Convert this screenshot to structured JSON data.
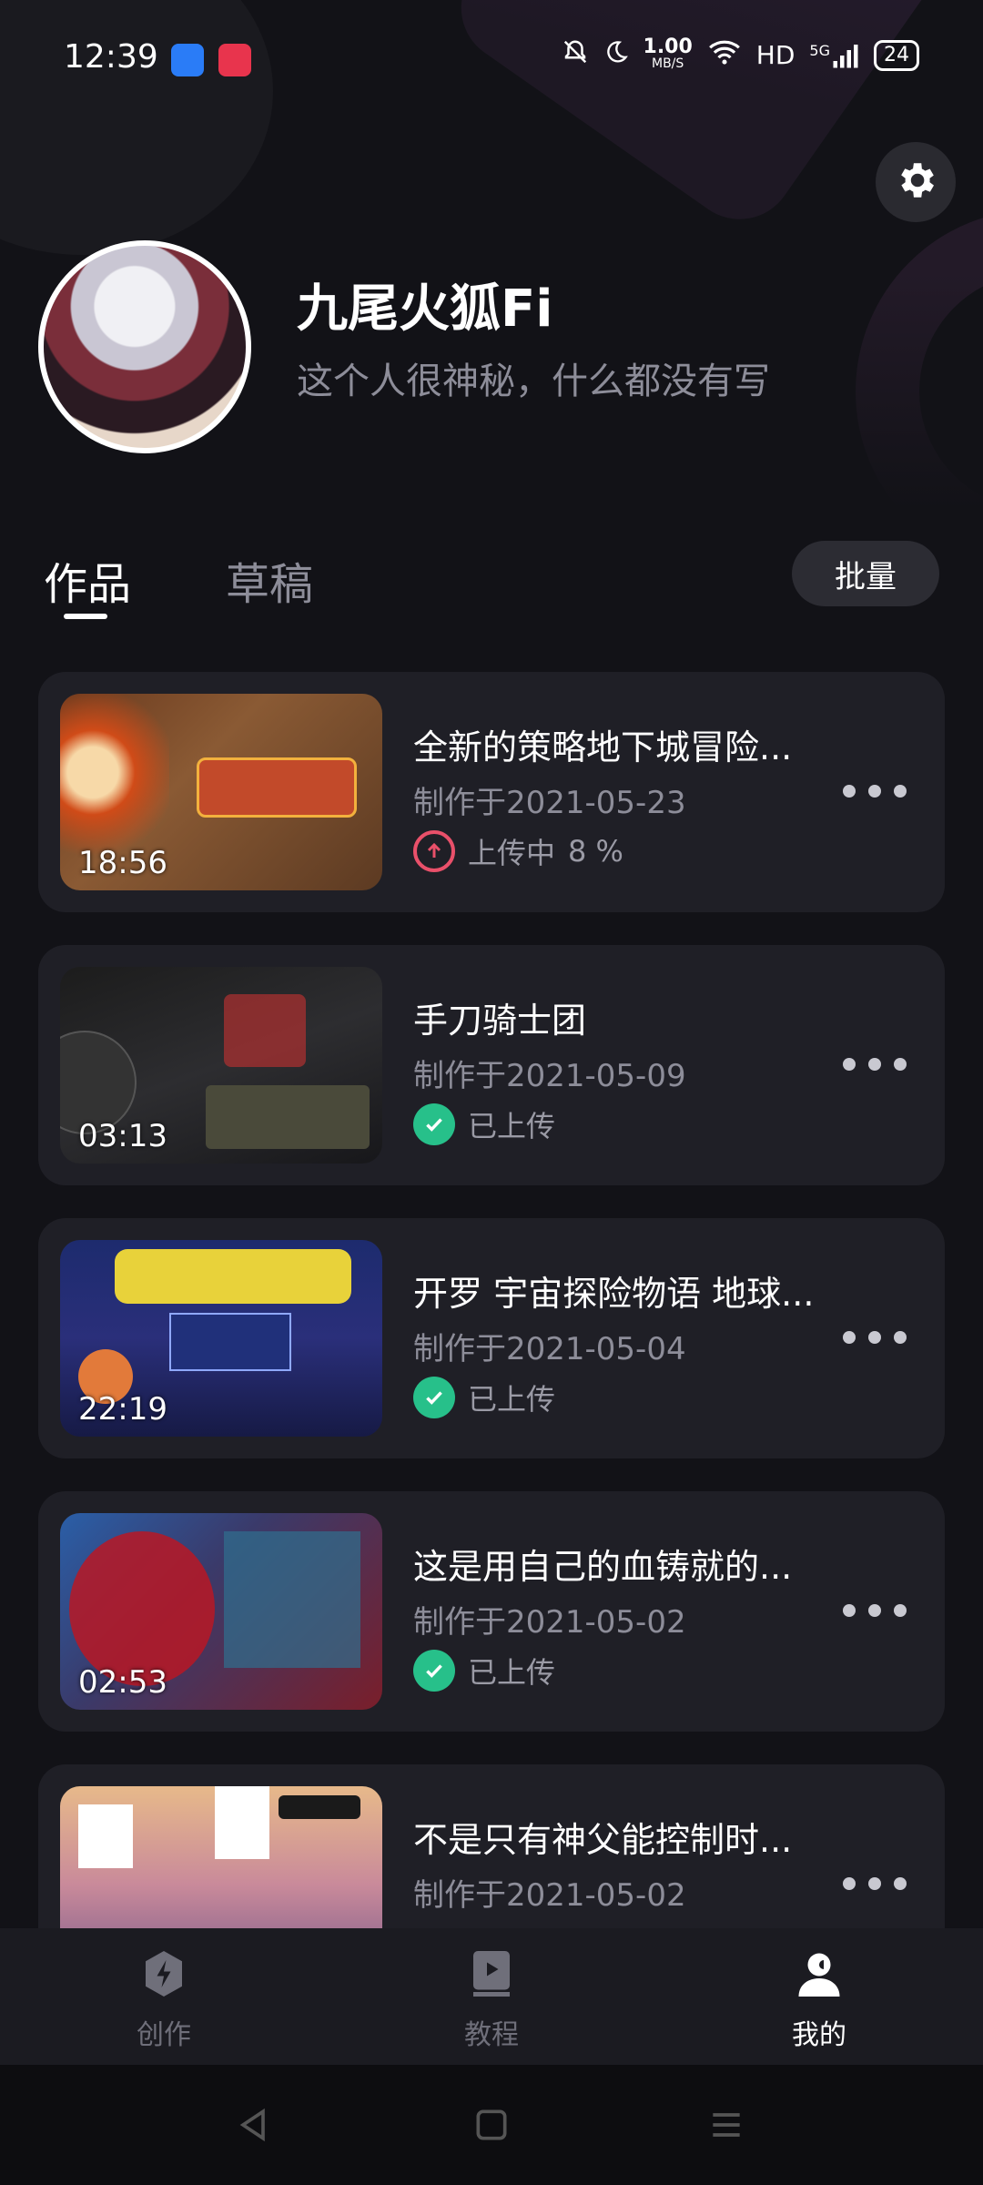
{
  "status_bar": {
    "time": "12:39",
    "net_speed_value": "1.00",
    "net_speed_unit": "MB/S",
    "hd": "HD",
    "signal": "5G",
    "battery": "24"
  },
  "profile": {
    "username": "九尾火狐Fi",
    "bio": "这个人很神秘，什么都没有写"
  },
  "tabs": {
    "works": "作品",
    "drafts": "草稿",
    "batch_button": "批量"
  },
  "videos": [
    {
      "title": "全新的策略地下城冒险...",
      "date": "制作于2021-05-23",
      "duration": "18:56",
      "status": "上传中",
      "progress_text": "8 %",
      "progress": 0.08
    },
    {
      "title": "手刀骑士团",
      "date": "制作于2021-05-09",
      "duration": "03:13",
      "status": "已上传"
    },
    {
      "title": "开罗 宇宙探险物语 地球...",
      "date": "制作于2021-05-04",
      "duration": "22:19",
      "status": "已上传"
    },
    {
      "title": "这是用自己的血铸就的...",
      "date": "制作于2021-05-02",
      "duration": "02:53",
      "status": "已上传"
    },
    {
      "title": "不是只有神父能控制时...",
      "date": "制作于2021-05-02",
      "duration": "",
      "status": ""
    }
  ],
  "bottom_nav": {
    "create": "创作",
    "tutorial": "教程",
    "mine": "我的"
  },
  "colors": {
    "accent_green": "#27c08a",
    "upload_pink": "#e9506a",
    "card_bg": "#1f1f26",
    "page_bg": "#121217"
  },
  "icons": {
    "settings": "gear-icon",
    "more": "more-dots-icon",
    "uploaded": "check-circle-icon",
    "uploading": "upload-arrow-icon",
    "create": "lightning-icon",
    "tutorial": "play-book-icon",
    "mine": "person-icon"
  }
}
